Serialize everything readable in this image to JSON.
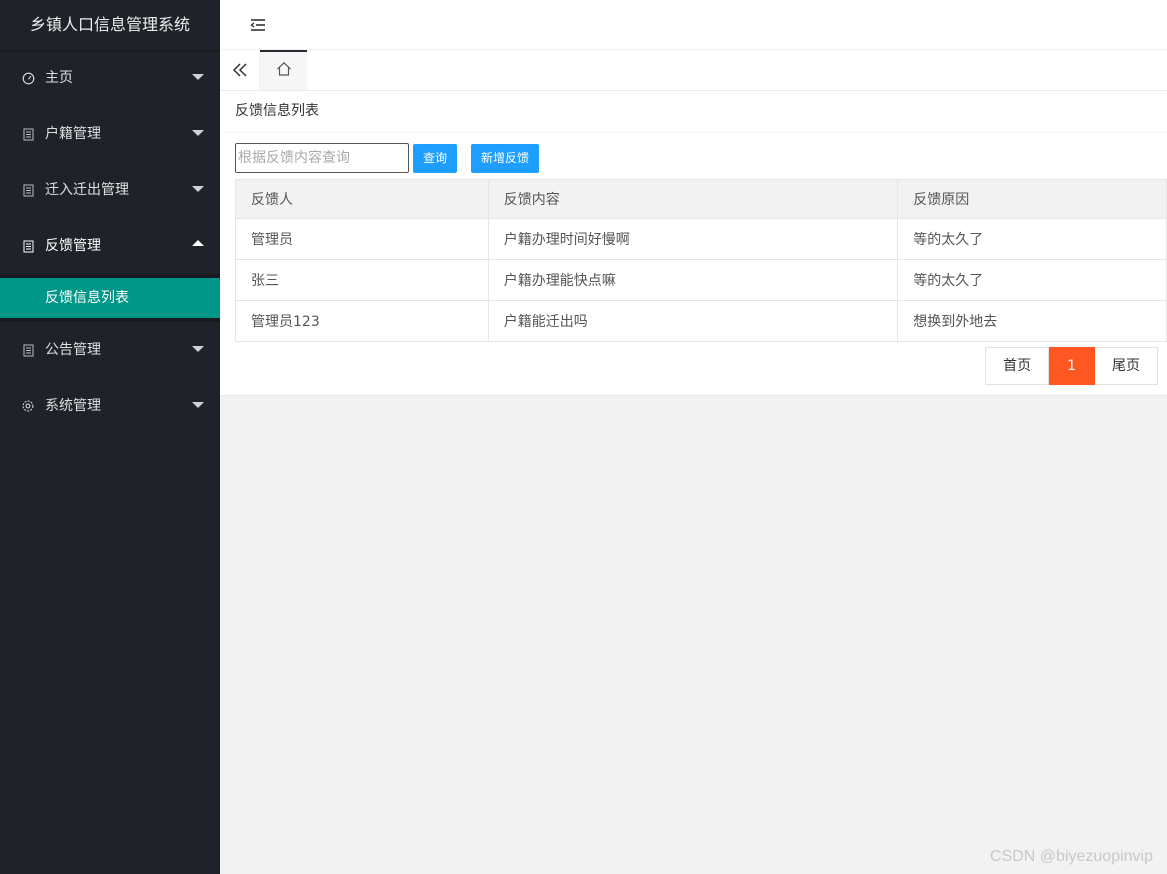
{
  "app": {
    "title": "乡镇人口信息管理系统"
  },
  "sidebar": {
    "items": [
      {
        "label": "主页",
        "icon": "dashboard-icon",
        "expanded": false
      },
      {
        "label": "户籍管理",
        "icon": "document-icon",
        "expanded": false
      },
      {
        "label": "迁入迁出管理",
        "icon": "document-icon",
        "expanded": false
      },
      {
        "label": "反馈管理",
        "icon": "document-icon",
        "expanded": true,
        "children": [
          {
            "label": "反馈信息列表",
            "active": true
          }
        ]
      },
      {
        "label": "公告管理",
        "icon": "document-icon",
        "expanded": false
      },
      {
        "label": "系统管理",
        "icon": "gear-icon",
        "expanded": false
      }
    ]
  },
  "header": {
    "menu_toggle_icon": "indent-icon"
  },
  "tabs": {
    "prev_icon": "double-chevron-left-icon",
    "home_icon": "home-icon"
  },
  "main": {
    "card_title": "反馈信息列表",
    "search": {
      "placeholder": "根据反馈内容查询",
      "value": ""
    },
    "buttons": {
      "query": "查询",
      "add": "新增反馈"
    },
    "table": {
      "columns": [
        "反馈人",
        "反馈内容",
        "反馈原因"
      ],
      "rows": [
        [
          "管理员",
          "户籍办理时间好慢啊",
          "等的太久了"
        ],
        [
          "张三",
          "户籍办理能快点嘛",
          "等的太久了"
        ],
        [
          "管理员123",
          "户籍能迁出吗",
          "想换到外地去"
        ]
      ]
    },
    "pagination": {
      "first": "首页",
      "current": "1",
      "last": "尾页"
    }
  },
  "watermark": "CSDN @biyezuopinvip",
  "colors": {
    "sidebar_bg": "#20222a",
    "active_item": "#009688",
    "primary_button": "#1e9fff",
    "current_page": "#ff5722"
  }
}
